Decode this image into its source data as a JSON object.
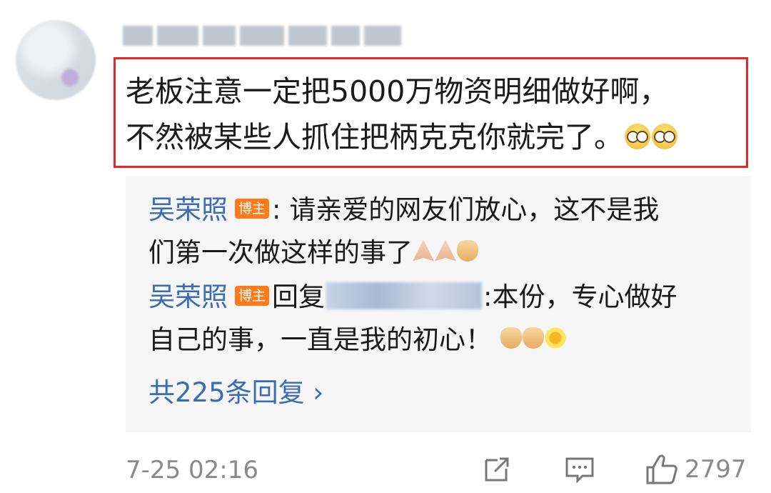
{
  "comment": {
    "line1": "老板注意一定把5000万物资明细做好啊，",
    "line2": "不然被某些人抓住把柄克克你就完了。",
    "emoji": [
      "glasses-face-emoji",
      "glasses-face-emoji"
    ]
  },
  "replies": [
    {
      "author": "吴荣照",
      "badge": "博主",
      "separator": ":",
      "text_part1": " 请亲爱的网友们放心，这不是我",
      "text_part2": "们第一次做这样的事了",
      "emoji": [
        "folded-hands-emoji",
        "folded-hands-emoji",
        "handshake-emoji"
      ]
    },
    {
      "author": "吴荣照",
      "badge": "博主",
      "reply_prefix": "回复",
      "text_part1": ":本份，专心做好",
      "text_part2": "自己的事，一直是我的初心！",
      "emoji": [
        "handshake-emoji",
        "handshake-emoji",
        "sunflower-smile-emoji"
      ]
    }
  ],
  "more_replies": "共225条回复 ›",
  "footer": {
    "timestamp": "7-25 02:16",
    "like_count": "2797",
    "icons": [
      "share-icon",
      "comment-icon",
      "like-icon"
    ]
  },
  "colors": {
    "highlight_border": "#e8262a",
    "link_blue": "#3a6bb5",
    "badge_orange": "#ff7a1a",
    "reply_bg": "#f6f6f6",
    "muted_text": "#8a8a8a"
  }
}
